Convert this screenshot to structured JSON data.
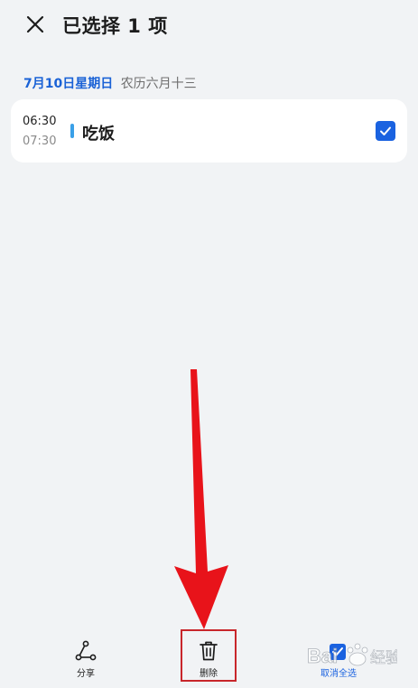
{
  "header": {
    "title": "已选择 1 项",
    "close_icon": "close-icon"
  },
  "date": {
    "main": "7月10日星期日",
    "lunar": "农历六月十三"
  },
  "event": {
    "start_time": "06:30",
    "end_time": "07:30",
    "title": "吃饭",
    "bar_color": "#3aa0e8",
    "checked": true
  },
  "toolbar": {
    "share_label": "分享",
    "delete_label": "删除",
    "deselect_label": "取消全选"
  },
  "colors": {
    "accent": "#1a62e0",
    "date_blue": "#1a62d6",
    "annotation_red": "#e8131a",
    "background": "#f1f3f5"
  },
  "watermark": {
    "text": "Bai经验"
  }
}
